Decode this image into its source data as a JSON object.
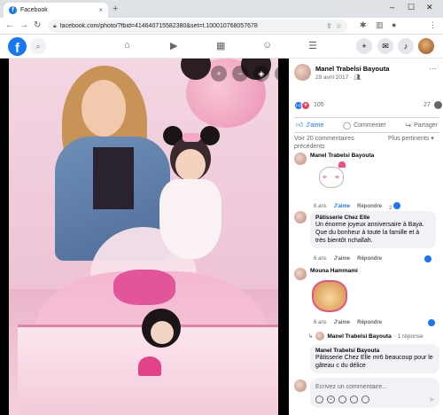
{
  "browser": {
    "tab_title": "Facebook",
    "tab_close": "×",
    "new_tab": "+",
    "url": "facebook.com/photo/?fbid=414640715582380&set=t.100010768057678",
    "win_min": "–",
    "win_max": "☐",
    "win_close": "✕"
  },
  "fb_header": {
    "logo": "f"
  },
  "post": {
    "author": "Manel Trabelsi Bayouta",
    "date": "29 avril 2017 · ",
    "more": "···",
    "reaction_count": "105",
    "comment_count": "27",
    "like_label": "J'aime",
    "comment_label": "Commenter",
    "share_label": "Partager",
    "previous_comments": "Voir 20 commentaires précédents",
    "sort_label": "Plus pertinents ▾"
  },
  "comments": [
    {
      "author": "Manel Trabelsi Bayouta",
      "text": "",
      "age": "6 ans",
      "like": "J'aime",
      "reply": "Répondre",
      "badge_count": "2"
    },
    {
      "author": "Pâtisserie Chez Elle",
      "text": "Un énorme joyeux anniversaire à Baya. Que du bonheur à toute la famille et à très bientôt nchallah.",
      "age": "6 ans",
      "like": "J'aime",
      "reply": "Répondre"
    },
    {
      "author": "Mouna Hammami",
      "text": "",
      "age": "6 ans",
      "like": "J'aime",
      "reply": "Répondre"
    },
    {
      "author": "Manel Trabelsi Bayouta",
      "text": "Pâtisserie Chez Elle mr6 beaucoup pour le gâteau c du délice"
    }
  ],
  "reply_thread": {
    "author": "Manel Trabelsi Bayouta",
    "count": "· 1 réponse"
  },
  "composer": {
    "placeholder": "Écrivez un commentaire..."
  },
  "colors": {
    "facebook_blue": "#1877f2",
    "love_red": "#f33e58"
  },
  "icons": [
    "search-icon",
    "home-icon",
    "watch-icon",
    "marketplace-icon",
    "groups-icon",
    "menu-icon",
    "plus-icon",
    "messenger-icon",
    "bell-icon",
    "zoom-in-icon",
    "zoom-out-icon",
    "tag-icon",
    "fullscreen-icon"
  ]
}
